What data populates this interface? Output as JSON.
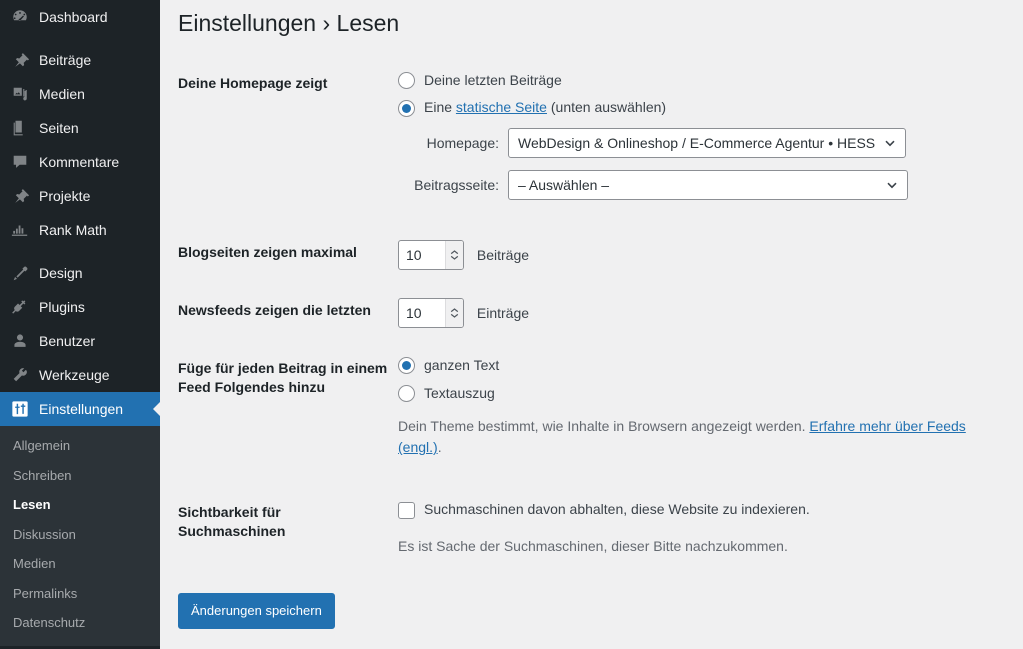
{
  "sidebar": {
    "groups": [
      {
        "items": [
          {
            "label": "Dashboard",
            "icon": "dashboard-icon"
          }
        ]
      },
      {
        "items": [
          {
            "label": "Beiträge",
            "icon": "pin-icon"
          },
          {
            "label": "Medien",
            "icon": "media-icon"
          },
          {
            "label": "Seiten",
            "icon": "pages-icon"
          },
          {
            "label": "Kommentare",
            "icon": "comment-icon"
          },
          {
            "label": "Projekte",
            "icon": "pin-icon"
          },
          {
            "label": "Rank Math",
            "icon": "chart-icon"
          }
        ]
      },
      {
        "items": [
          {
            "label": "Design",
            "icon": "brush-icon"
          },
          {
            "label": "Plugins",
            "icon": "plug-icon"
          },
          {
            "label": "Benutzer",
            "icon": "user-icon"
          },
          {
            "label": "Werkzeuge",
            "icon": "wrench-icon"
          },
          {
            "label": "Einstellungen",
            "icon": "settings-icon",
            "current": true
          }
        ]
      }
    ],
    "submenu": {
      "items": [
        {
          "label": "Allgemein"
        },
        {
          "label": "Schreiben"
        },
        {
          "label": "Lesen",
          "current": true
        },
        {
          "label": "Diskussion"
        },
        {
          "label": "Medien"
        },
        {
          "label": "Permalinks"
        },
        {
          "label": "Datenschutz"
        }
      ]
    },
    "colors": {
      "background": "#1d2327",
      "submenu_background": "#2c3338",
      "current": "#2271b1"
    }
  },
  "page": {
    "title": "Einstellungen › Lesen"
  },
  "form": {
    "homepage": {
      "label": "Deine Homepage zeigt",
      "option_posts": "Deine letzten Beiträge",
      "option_static_prefix": "Eine ",
      "option_static_link": "statische Seite",
      "option_static_suffix": " (unten auswählen)",
      "selected": "static",
      "homepage_select_label": "Homepage:",
      "homepage_select_value": "WebDesign & Onlineshop / E-Commerce Agentur • HESS M",
      "postspage_select_label": "Beitragsseite:",
      "postspage_select_value": "– Auswählen –"
    },
    "posts_per_page": {
      "label": "Blogseiten zeigen maximal",
      "value": "10",
      "unit": "Beiträge"
    },
    "posts_per_rss": {
      "label": "Newsfeeds zeigen die letzten",
      "value": "10",
      "unit": "Einträge"
    },
    "feed_content": {
      "label": "Füge für jeden Beitrag in einem Feed Folgendes hinzu",
      "option_full": "ganzen Text",
      "option_excerpt": "Textauszug",
      "selected": "full",
      "description_text": "Dein Theme bestimmt, wie Inhalte in Browsern angezeigt werden. ",
      "description_link": "Erfahre mehr über Feeds (engl.)",
      "description_suffix": "."
    },
    "search_visibility": {
      "label": "Sichtbarkeit für Suchmaschinen",
      "checkbox_label": "Suchmaschinen davon abhalten, diese Website zu indexieren.",
      "checked": false,
      "description": "Es ist Sache der Suchmaschinen, dieser Bitte nachzukommen."
    },
    "submit_label": "Änderungen speichern"
  }
}
